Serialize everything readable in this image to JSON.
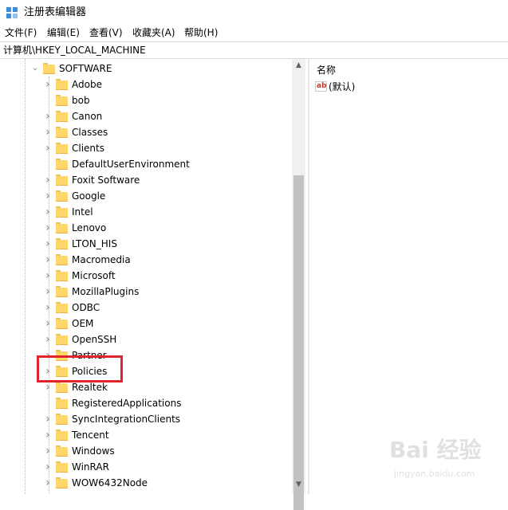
{
  "window": {
    "title": "注册表编辑器"
  },
  "menu": {
    "items": [
      {
        "label": "文件(F)"
      },
      {
        "label": "编辑(E)"
      },
      {
        "label": "查看(V)"
      },
      {
        "label": "收藏夹(A)"
      },
      {
        "label": "帮助(H)"
      }
    ]
  },
  "address": {
    "path": "计算机\\HKEY_LOCAL_MACHINE"
  },
  "tree": {
    "parent": {
      "label": "SOFTWARE",
      "expanded": true
    },
    "children": [
      {
        "label": "Adobe",
        "has_children": true
      },
      {
        "label": "bob",
        "has_children": false
      },
      {
        "label": "Canon",
        "has_children": true
      },
      {
        "label": "Classes",
        "has_children": true
      },
      {
        "label": "Clients",
        "has_children": true
      },
      {
        "label": "DefaultUserEnvironment",
        "has_children": false
      },
      {
        "label": "Foxit Software",
        "has_children": true
      },
      {
        "label": "Google",
        "has_children": true
      },
      {
        "label": "Intel",
        "has_children": true
      },
      {
        "label": "Lenovo",
        "has_children": true
      },
      {
        "label": "LTON_HIS",
        "has_children": true
      },
      {
        "label": "Macromedia",
        "has_children": true
      },
      {
        "label": "Microsoft",
        "has_children": true
      },
      {
        "label": "MozillaPlugins",
        "has_children": true
      },
      {
        "label": "ODBC",
        "has_children": true
      },
      {
        "label": "OEM",
        "has_children": true
      },
      {
        "label": "OpenSSH",
        "has_children": true
      },
      {
        "label": "Partner",
        "has_children": true
      },
      {
        "label": "Policies",
        "has_children": true
      },
      {
        "label": "Realtek",
        "has_children": true
      },
      {
        "label": "RegisteredApplications",
        "has_children": false
      },
      {
        "label": "SyncIntegrationClients",
        "has_children": true
      },
      {
        "label": "Tencent",
        "has_children": true
      },
      {
        "label": "Windows",
        "has_children": true
      },
      {
        "label": "WinRAR",
        "has_children": true
      },
      {
        "label": "WOW6432Node",
        "has_children": true
      }
    ]
  },
  "list": {
    "column_name": "名称",
    "values": [
      {
        "icon": "ab",
        "name": "(默认)"
      }
    ]
  },
  "watermark": {
    "logo": "Bai 经验",
    "url": "jingyan.baidu.com"
  },
  "colors": {
    "folder": "#fcd86b",
    "highlight": "#e0242b",
    "scroll_thumb": "#c2c2c2"
  }
}
